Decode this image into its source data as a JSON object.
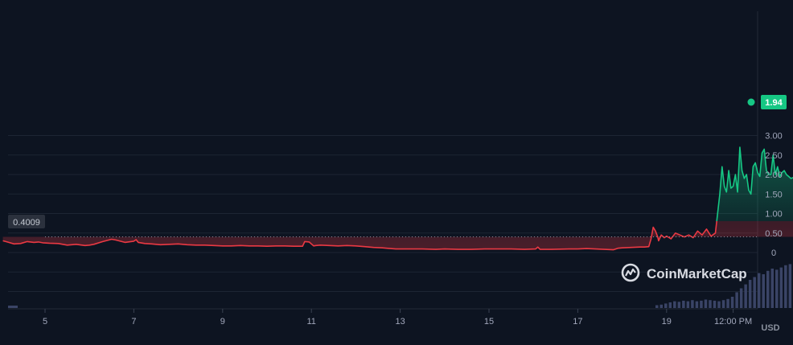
{
  "chart_data": {
    "type": "line",
    "title": "",
    "xlabel": "",
    "ylabel": "",
    "unit_label": "USD",
    "brand": "CoinMarketCap",
    "reference_price": "0.4009",
    "current_price": "1.94",
    "ylim": [
      0,
      3.0
    ],
    "y_ticks": [
      "3.00",
      "2.50",
      "2.00",
      "1.50",
      "1.00",
      "0.50",
      "0"
    ],
    "x_ticks": [
      "5",
      "7",
      "9",
      "11",
      "13",
      "15",
      "17",
      "19",
      "12:00 PM"
    ],
    "grid": true,
    "colors": {
      "up": "#16c784",
      "down": "#ea3943",
      "reference": "#8a919e",
      "volume": "#3a4466",
      "background": "#0d1421"
    },
    "series": [
      {
        "x": [
          4.05,
          4.15,
          4.3,
          4.45,
          4.6,
          4.75,
          4.85,
          4.95,
          5.1,
          5.3,
          5.5,
          5.7,
          5.9,
          6.0,
          6.1,
          6.3,
          6.5,
          6.6,
          6.8,
          7.0,
          7.05,
          7.1,
          7.25,
          7.4,
          7.6,
          7.8,
          8.0,
          8.2,
          8.4,
          8.6,
          8.8,
          9.0,
          9.2,
          9.4,
          9.6,
          9.8,
          10.0,
          10.2,
          10.4,
          10.6,
          10.8,
          10.85,
          10.95,
          11.05,
          11.1,
          11.2,
          11.4,
          11.6,
          11.8,
          12.0,
          12.2,
          12.4,
          12.6,
          12.7,
          12.9,
          13.2,
          13.5,
          13.8,
          14.0,
          14.3,
          14.6,
          14.9,
          15.2,
          15.5,
          15.8,
          16.05,
          16.1,
          16.15,
          16.4,
          16.8,
          17.0,
          17.2,
          17.4,
          17.6,
          17.8,
          17.9,
          18.0,
          18.2,
          18.4,
          18.5,
          18.6,
          18.65,
          18.7,
          18.75,
          18.8,
          18.82,
          18.88,
          18.95,
          19.0,
          19.1,
          19.2,
          19.3,
          19.4,
          19.5,
          19.6,
          19.7,
          19.8,
          19.9,
          20.0,
          20.1,
          20.2,
          20.25,
          20.3,
          20.35,
          20.4,
          20.45,
          20.5,
          20.55,
          20.6,
          20.65,
          20.7,
          20.75,
          20.8,
          20.85,
          20.9,
          20.95,
          21.0,
          21.05,
          21.1,
          21.15,
          21.2,
          21.25,
          21.3,
          21.35,
          21.4,
          21.45,
          21.5,
          21.55,
          21.6,
          21.65,
          21.7,
          21.75,
          21.8,
          21.9
        ],
        "y": [
          0.3,
          0.27,
          0.22,
          0.23,
          0.28,
          0.26,
          0.27,
          0.25,
          0.24,
          0.23,
          0.19,
          0.21,
          0.18,
          0.19,
          0.21,
          0.28,
          0.34,
          0.32,
          0.26,
          0.29,
          0.33,
          0.26,
          0.23,
          0.22,
          0.2,
          0.21,
          0.22,
          0.2,
          0.19,
          0.19,
          0.18,
          0.17,
          0.17,
          0.18,
          0.17,
          0.17,
          0.16,
          0.17,
          0.17,
          0.16,
          0.16,
          0.28,
          0.27,
          0.17,
          0.18,
          0.19,
          0.18,
          0.17,
          0.18,
          0.17,
          0.15,
          0.13,
          0.12,
          0.11,
          0.09,
          0.09,
          0.09,
          0.08,
          0.09,
          0.08,
          0.08,
          0.09,
          0.09,
          0.09,
          0.08,
          0.09,
          0.14,
          0.08,
          0.08,
          0.09,
          0.09,
          0.1,
          0.09,
          0.08,
          0.07,
          0.11,
          0.12,
          0.13,
          0.14,
          0.14,
          0.15,
          0.35,
          0.65,
          0.55,
          0.4,
          0.3,
          0.45,
          0.38,
          0.42,
          0.35,
          0.5,
          0.45,
          0.4,
          0.45,
          0.38,
          0.55,
          0.45,
          0.6,
          0.42,
          0.5,
          1.5,
          2.2,
          1.7,
          1.55,
          2.1,
          1.65,
          1.7,
          2.0,
          1.55,
          2.7,
          2.1,
          1.9,
          2.0,
          1.6,
          1.5,
          2.2,
          2.3,
          2.05,
          1.95,
          2.55,
          2.65,
          2.1,
          2.0,
          2.0,
          2.5,
          2.0,
          2.2,
          1.95,
          2.05,
          2.1,
          2.0,
          1.95,
          1.9,
          1.94
        ]
      }
    ],
    "volume": [
      0.05,
      0.06,
      0.08,
      0.1,
      0.12,
      0.11,
      0.13,
      0.12,
      0.14,
      0.12,
      0.13,
      0.15,
      0.14,
      0.13,
      0.12,
      0.14,
      0.16,
      0.2,
      0.28,
      0.35,
      0.42,
      0.5,
      0.55,
      0.62,
      0.6,
      0.66,
      0.7,
      0.68,
      0.72,
      0.76,
      0.78,
      0.74,
      0.7
    ]
  }
}
